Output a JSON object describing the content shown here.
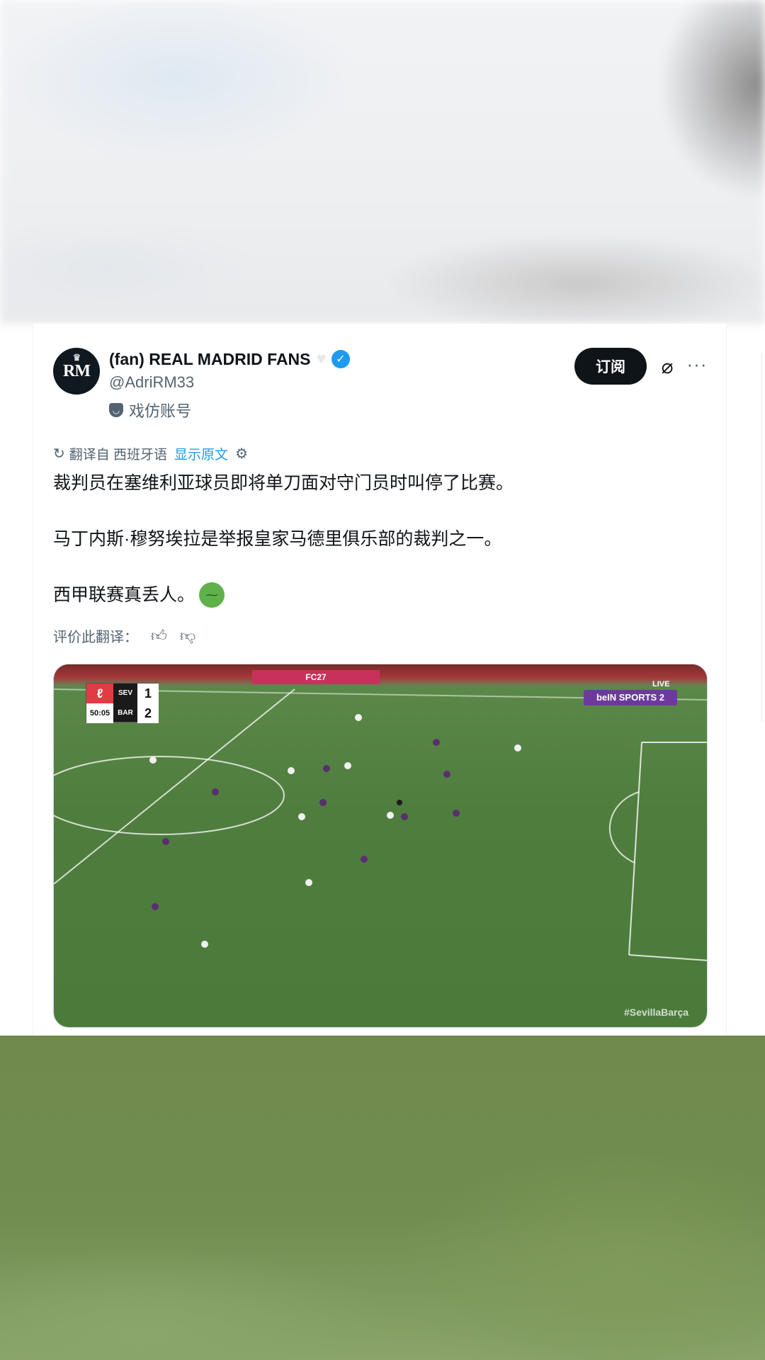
{
  "author": {
    "avatar_text": "RM",
    "name": "(fan) REAL MADRID FANS",
    "handle": "@AdriRM33",
    "parody_label": "戏仿账号"
  },
  "actions": {
    "subscribe_label": "订阅",
    "grok_icon": "grok-icon",
    "more_icon": "more-icon"
  },
  "translation": {
    "translated_from": "翻译自 西班牙语",
    "show_original": "显示原文",
    "rate_label": "评价此翻译："
  },
  "post": {
    "line1": "裁判员在塞维利亚球员即将单刀面对守门员时叫停了比赛。",
    "line2": "马丁内斯·穆努埃拉是举报皇家马德里俱乐部的裁判之一。",
    "line3": "西甲联赛真丢人。"
  },
  "media": {
    "ad_board": "FC27",
    "scoreboard": {
      "home_team": "SEV",
      "home_score": "1",
      "away_team": "BAR",
      "away_score": "2",
      "clock": "50:05"
    },
    "broadcaster": "beIN SPORTS 2",
    "live_label": "LIVE",
    "hashtag": "#SevillaBarça"
  },
  "colors": {
    "accent": "#1d9bf0",
    "text_primary": "#0f1419",
    "text_secondary": "#536471",
    "pitch": "#4f7d3e"
  }
}
